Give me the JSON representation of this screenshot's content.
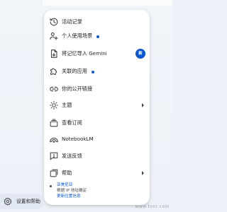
{
  "menu": {
    "items": [
      {
        "label": "活动记录",
        "icon": "history-icon"
      },
      {
        "label": "个人使用场景",
        "icon": "personal-context-icon",
        "has_dot": true
      },
      {
        "label": "将记忆导入 Gemini",
        "icon": "import-document-icon",
        "badge": "新"
      },
      {
        "label": "关联的应用",
        "icon": "puzzle-icon",
        "has_dot": true
      },
      {
        "label": "你的公开链接",
        "icon": "link-icon"
      },
      {
        "label": "主题",
        "icon": "brightness-icon",
        "has_submenu": true
      },
      {
        "label": "查看订阅",
        "icon": "subscriptions-icon"
      },
      {
        "label": "NotebookLM",
        "icon": "notebooklm-icon"
      },
      {
        "label": "发送反馈",
        "icon": "feedback-icon"
      },
      {
        "label": "帮助",
        "icon": "help-icon",
        "has_submenu": true
      }
    ]
  },
  "location": {
    "country": "亚美尼亚",
    "basis": "根据 IP 地址确定",
    "update_link": "更新位置信息"
  },
  "settings": {
    "label": "设置和帮助",
    "icon": "gear-icon"
  },
  "watermark": "www.tonr.com",
  "colors": {
    "accent": "#0b57d0",
    "icon": "#444746",
    "text": "#1f1f1f",
    "background": "#eef2f8",
    "menu_background": "#ffffff"
  }
}
